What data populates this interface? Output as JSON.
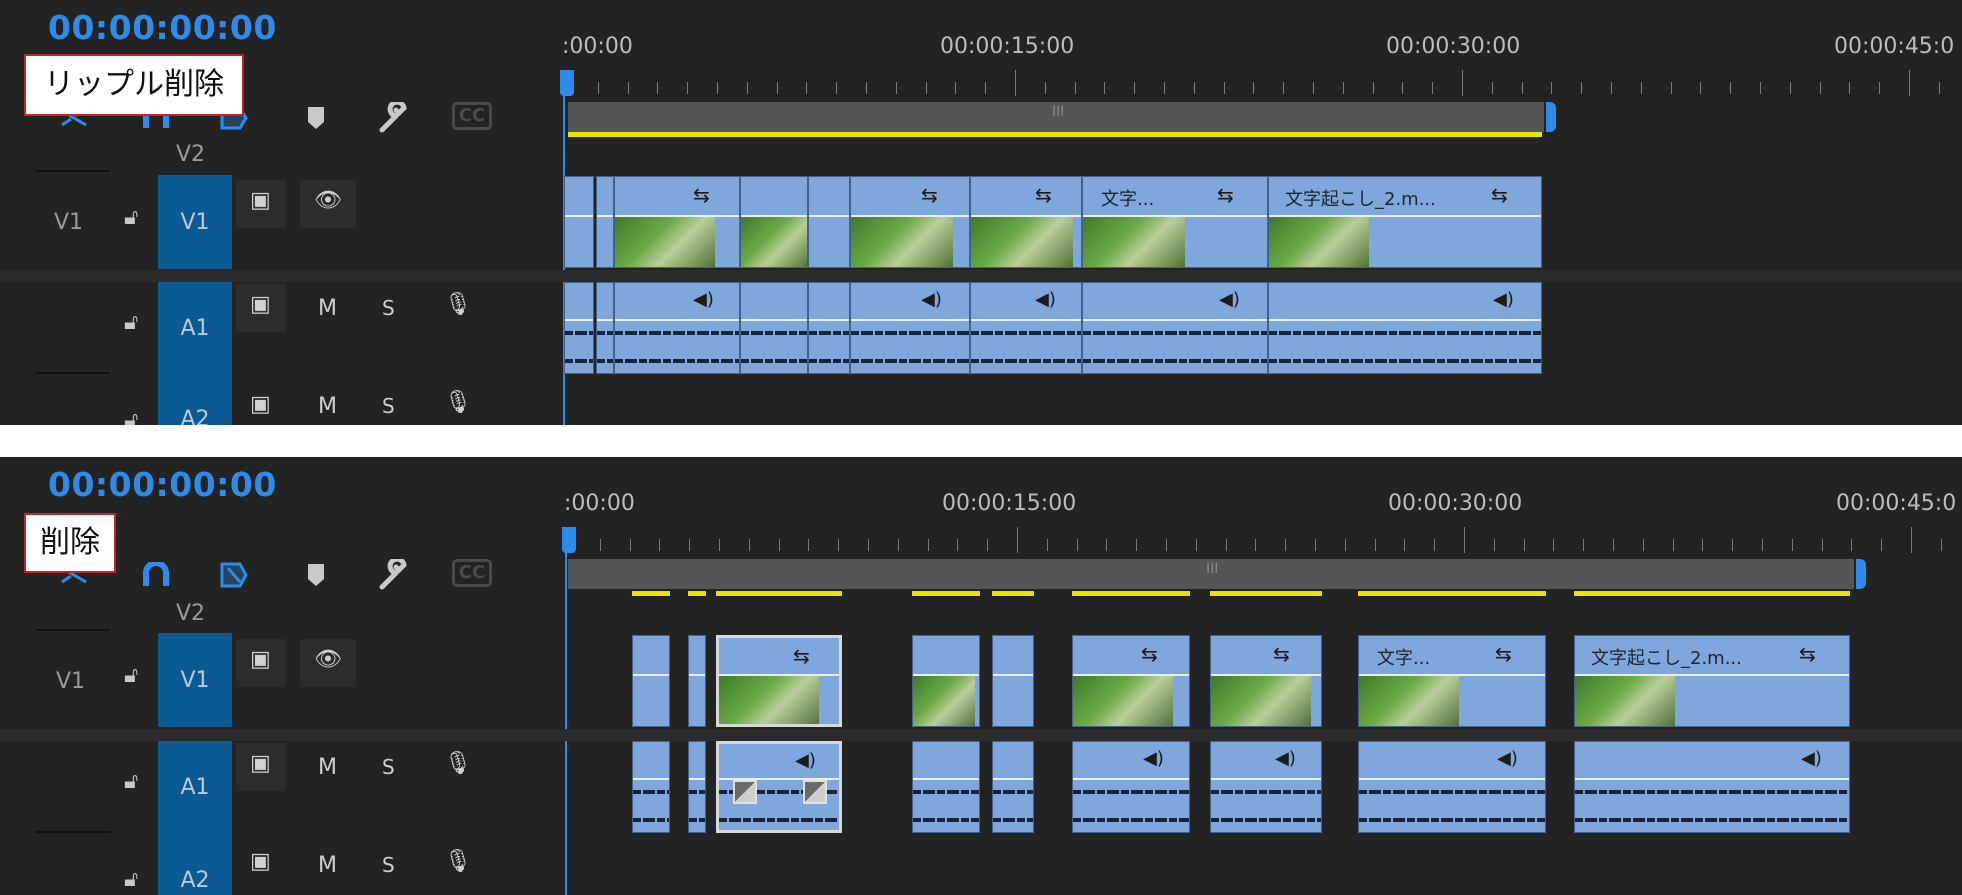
{
  "top": {
    "timecode": "00:00:00:00",
    "label": "リップル削除",
    "ruler": [
      ":00:00",
      "00:00:15:00",
      "00:00:30:00",
      "00:00:45:0"
    ],
    "tracks": {
      "v2": "V2",
      "v1_left": "V1",
      "v1": "V1",
      "a1": "A1",
      "a2": "A2",
      "m": "M",
      "s": "S"
    },
    "clip_titles": [
      "文字...",
      "文字起こし_2.m..."
    ]
  },
  "bottom": {
    "timecode": "00:00:00:00",
    "label": "削除",
    "ruler": [
      ":00:00",
      "00:00:15:00",
      "00:00:30:00",
      "00:00:45:0"
    ],
    "tracks": {
      "v2": "V2",
      "v1_left": "V1",
      "v1": "V1",
      "a1": "A1",
      "a2": "A2",
      "m": "M",
      "s": "S"
    },
    "clip_titles": [
      "文字...",
      "文字起こし_2.m..."
    ]
  },
  "icons": {
    "snap": "snap-magnet-icon",
    "linked": "linked-selection-icon",
    "marker": "add-marker-icon",
    "settings": "wrench-icon",
    "captions": "closed-captions-icon",
    "lock": "lock-icon",
    "camera": "track-output-icon",
    "eye": "eye-icon",
    "mic": "microphone-icon",
    "fx": "sync-lock-icon",
    "speaker": "audio-speaker-icon"
  },
  "colors": {
    "accent": "#2d8ceb",
    "clip": "#7fa7dc",
    "track_highlight": "#0c5a94",
    "work_area_line": "#e8e300",
    "label_border": "#c0262b"
  }
}
